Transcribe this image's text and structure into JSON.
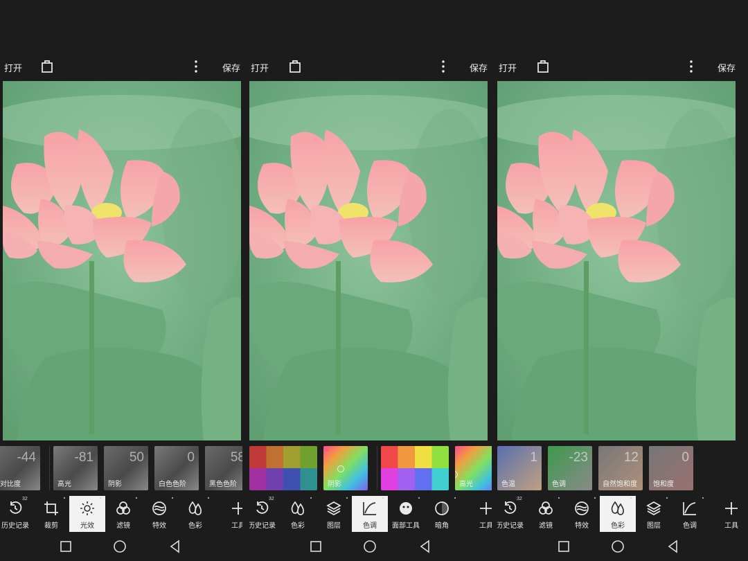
{
  "panels": [
    {
      "open_label": "打开",
      "save_label": "保存",
      "tiles": [
        {
          "value": "-44",
          "label": "对比度"
        },
        {
          "value": "-81",
          "label": "高光"
        },
        {
          "value": "50",
          "label": "阴影"
        },
        {
          "value": "0",
          "label": "白色色阶"
        },
        {
          "value": "58",
          "label": "黑色色阶"
        }
      ],
      "tools": [
        {
          "label": "历史记录",
          "icon": "history-icon",
          "badge": "32"
        },
        {
          "label": "裁剪",
          "icon": "crop-icon"
        },
        {
          "label": "光效",
          "icon": "light-icon",
          "active": true
        },
        {
          "label": "滤镜",
          "icon": "filter-icon"
        },
        {
          "label": "特效",
          "icon": "effects-icon"
        },
        {
          "label": "色彩",
          "icon": "color-icon"
        },
        {
          "label": "工具",
          "icon": "plus-icon"
        }
      ]
    },
    {
      "open_label": "打开",
      "save_label": "保存",
      "tiles": [
        {
          "label": "",
          "kind": "swatch-grid"
        },
        {
          "label": "阴影",
          "kind": "gradient"
        },
        {
          "label": "",
          "kind": "swatch-grid-bright"
        },
        {
          "label": "高光",
          "kind": "gradient"
        }
      ],
      "tools": [
        {
          "label": "历史记录",
          "icon": "history-icon",
          "badge": "32"
        },
        {
          "label": "色彩",
          "icon": "color-icon"
        },
        {
          "label": "图层",
          "icon": "layers-icon"
        },
        {
          "label": "色调",
          "icon": "curves-icon",
          "active": true
        },
        {
          "label": "面部工具",
          "icon": "face-icon"
        },
        {
          "label": "暗角",
          "icon": "vignette-icon"
        },
        {
          "label": "工具",
          "icon": "plus-icon"
        }
      ]
    },
    {
      "open_label": "打开",
      "save_label": "保存",
      "tiles": [
        {
          "value": "1",
          "label": "色温"
        },
        {
          "value": "-23",
          "label": "色调"
        },
        {
          "value": "12",
          "label": "自然饱和度"
        },
        {
          "value": "0",
          "label": "饱和度"
        }
      ],
      "tools": [
        {
          "label": "历史记录",
          "icon": "history-icon",
          "badge": "32"
        },
        {
          "label": "滤镜",
          "icon": "filter-icon"
        },
        {
          "label": "特效",
          "icon": "effects-icon"
        },
        {
          "label": "色彩",
          "icon": "color-icon",
          "active": true
        },
        {
          "label": "图层",
          "icon": "layers-icon"
        },
        {
          "label": "色调",
          "icon": "curves-icon"
        },
        {
          "label": "工具",
          "icon": "plus-icon"
        }
      ]
    }
  ],
  "colors": {
    "accent_bg": "#f2f2f2",
    "background": "#1c1c1c"
  }
}
